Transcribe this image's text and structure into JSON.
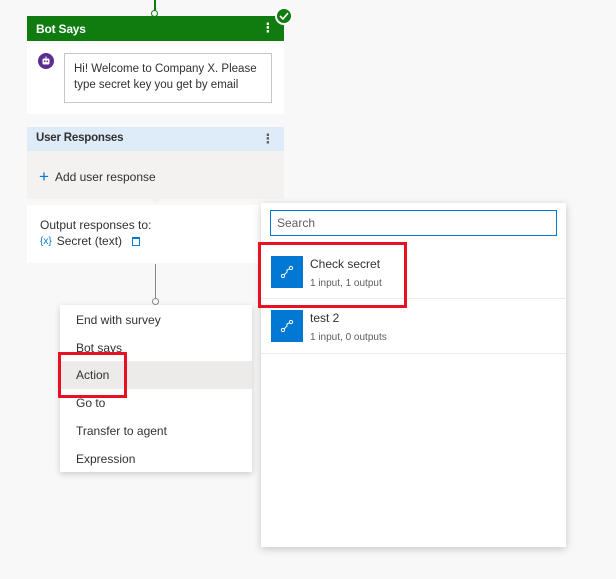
{
  "bot_says": {
    "title": "Bot Says",
    "menu_glyph": "⋮",
    "message": "Hi! Welcome to Company X. Please type secret key you get by email"
  },
  "user_responses": {
    "title": "User Responses",
    "menu_glyph": "⋮",
    "add_label": "Add user response",
    "output_label": "Output responses to:",
    "variable_glyph": "{x}",
    "variable": "Secret (text)"
  },
  "menu": {
    "items": [
      "End with survey",
      "Bot says",
      "Action",
      "Go to",
      "Transfer to agent",
      "Expression"
    ],
    "highlighted": "Action"
  },
  "picker": {
    "search_placeholder": "Search",
    "actions": [
      {
        "title": "Check secret",
        "subtitle": "1 input, 1 output",
        "icon": "flow-icon"
      },
      {
        "title": "test 2",
        "subtitle": "1 input, 0 outputs",
        "icon": "flow-icon"
      }
    ]
  },
  "colors": {
    "bot_header": "#107c10",
    "user_responses_header": "#deecf9",
    "accent": "#0078d4",
    "highlight_box": "#e81123"
  }
}
